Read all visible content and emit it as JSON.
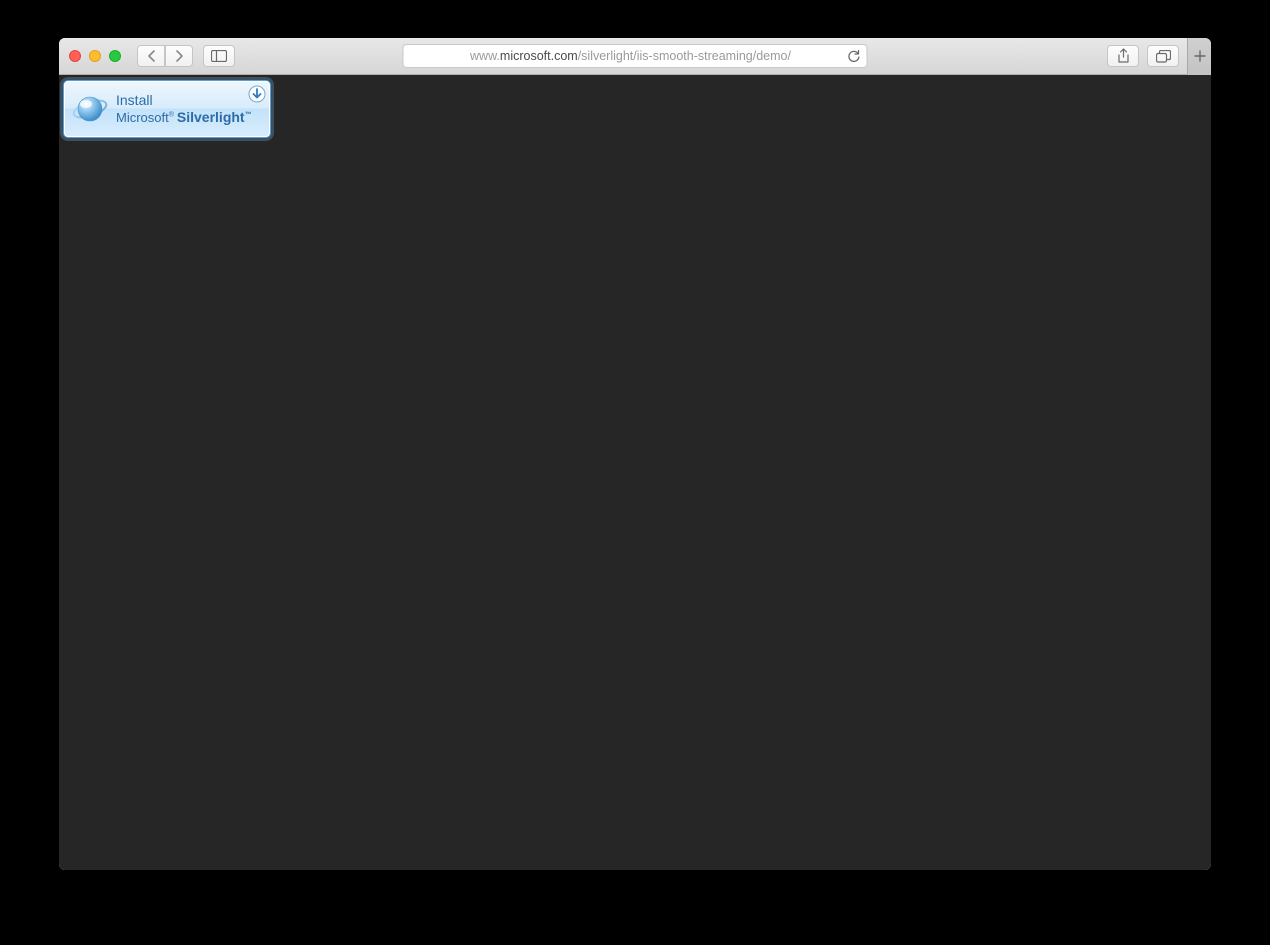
{
  "browser": {
    "url_prefix": "www.",
    "url_domain": "microsoft.com",
    "url_suffix": "/silverlight/iis-smooth-streaming/demo/"
  },
  "page": {
    "install_badge": {
      "line1": "Install",
      "brand_prefix": "Microsoft",
      "brand_name": "Silverlight"
    }
  },
  "icons": {
    "back": "chevron-left",
    "forward": "chevron-right",
    "sidebar": "sidebar-panel",
    "reload": "reload",
    "share": "share",
    "tabs": "tabs-overview",
    "newtab": "+"
  }
}
